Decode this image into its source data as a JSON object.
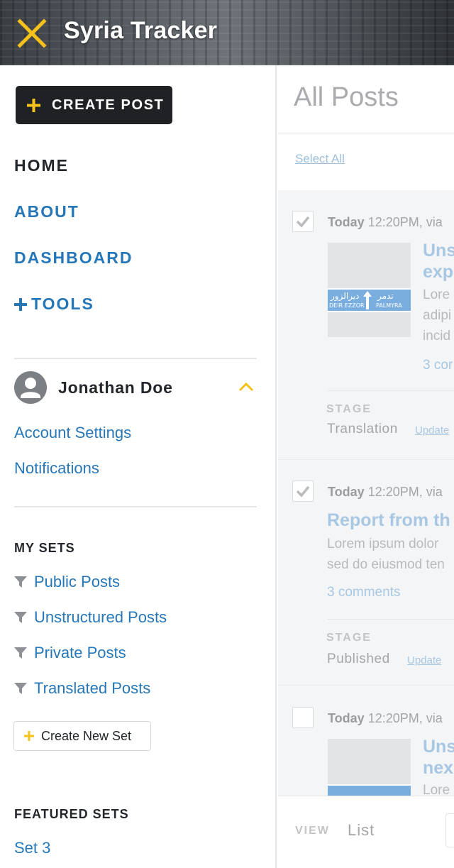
{
  "app": {
    "title": "Syria Tracker"
  },
  "colors": {
    "accent": "#f5c21b",
    "link": "#2677b8",
    "dark": "#1f2124"
  },
  "sidebar": {
    "create_post": "CREATE POST",
    "nav": {
      "home": "HOME",
      "about": "ABOUT",
      "dashboard": "DASHBOARD",
      "tools": "TOOLS"
    },
    "user": {
      "name": "Jonathan Doe",
      "links": [
        "Account Settings",
        "Notifications"
      ]
    },
    "my_sets": {
      "title": "MY SETS",
      "items": [
        "Public Posts",
        "Unstructured Posts",
        "Private Posts",
        "Translated Posts"
      ],
      "create_label": "Create New Set"
    },
    "featured_sets": {
      "title": "FEATURED SETS",
      "items": [
        "Set 3"
      ]
    }
  },
  "main": {
    "title": "All Posts",
    "select_all": "Select All",
    "posts": [
      {
        "checked": true,
        "day": "Today",
        "meta": "12:20PM, via",
        "title_lines": [
          "Uns",
          "exp"
        ],
        "body_lines": [
          "Lore",
          "adipi",
          "incid"
        ],
        "comments": "3 cor",
        "stage_label": "STAGE",
        "stage": "Translation",
        "update": "Update"
      },
      {
        "checked": true,
        "day": "Today",
        "meta": "12:20PM, via",
        "title_lines": [
          "Report from th"
        ],
        "body_lines": [
          "Lorem ipsum dolor",
          "sed do eiusmod ten"
        ],
        "comments": "3 comments",
        "stage_label": "STAGE",
        "stage": "Published",
        "update": "Update"
      },
      {
        "checked": false,
        "day": "Today",
        "meta": "12:20PM, via",
        "title_lines": [
          "Uns",
          "nex"
        ],
        "body_lines": [
          "Lore"
        ]
      }
    ],
    "sign": {
      "arabic_left": "ديرالزور",
      "arabic_right": "تدمر",
      "latin_left": "DEIR EZZOR",
      "latin_right": "PALMYRA"
    },
    "view": {
      "label": "VIEW",
      "value": "List"
    }
  }
}
